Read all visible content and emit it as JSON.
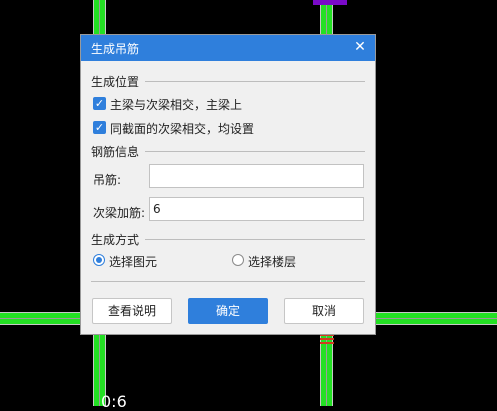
{
  "canvas": {
    "coord_text": "0:6",
    "colors": {
      "beam": "#23e023",
      "column_mark": "#7a0ac8",
      "rebar_mark": "#d23c1e",
      "background": "#000000"
    }
  },
  "dialog": {
    "title": "生成吊筋",
    "close_icon": "close-icon",
    "sections": {
      "position": "生成位置",
      "rebar_info": "钢筋信息",
      "method": "生成方式"
    },
    "options": {
      "main_secondary": {
        "label": "主梁与次梁相交，主梁上",
        "checked": true
      },
      "same_section": {
        "label": "同截面的次梁相交，均设置",
        "checked": true
      }
    },
    "fields": {
      "hanger": {
        "label": "吊筋:",
        "value": ""
      },
      "secondary_add": {
        "label": "次梁加筋:",
        "value": "6"
      }
    },
    "methods": {
      "select_element": {
        "label": "选择图元",
        "selected": true
      },
      "select_floor": {
        "label": "选择楼层",
        "selected": false
      }
    },
    "buttons": {
      "help": "查看说明",
      "ok": "确定",
      "cancel": "取消"
    },
    "colors": {
      "titlebar": "#2f7fdc",
      "primary": "#2f7fdc"
    }
  }
}
